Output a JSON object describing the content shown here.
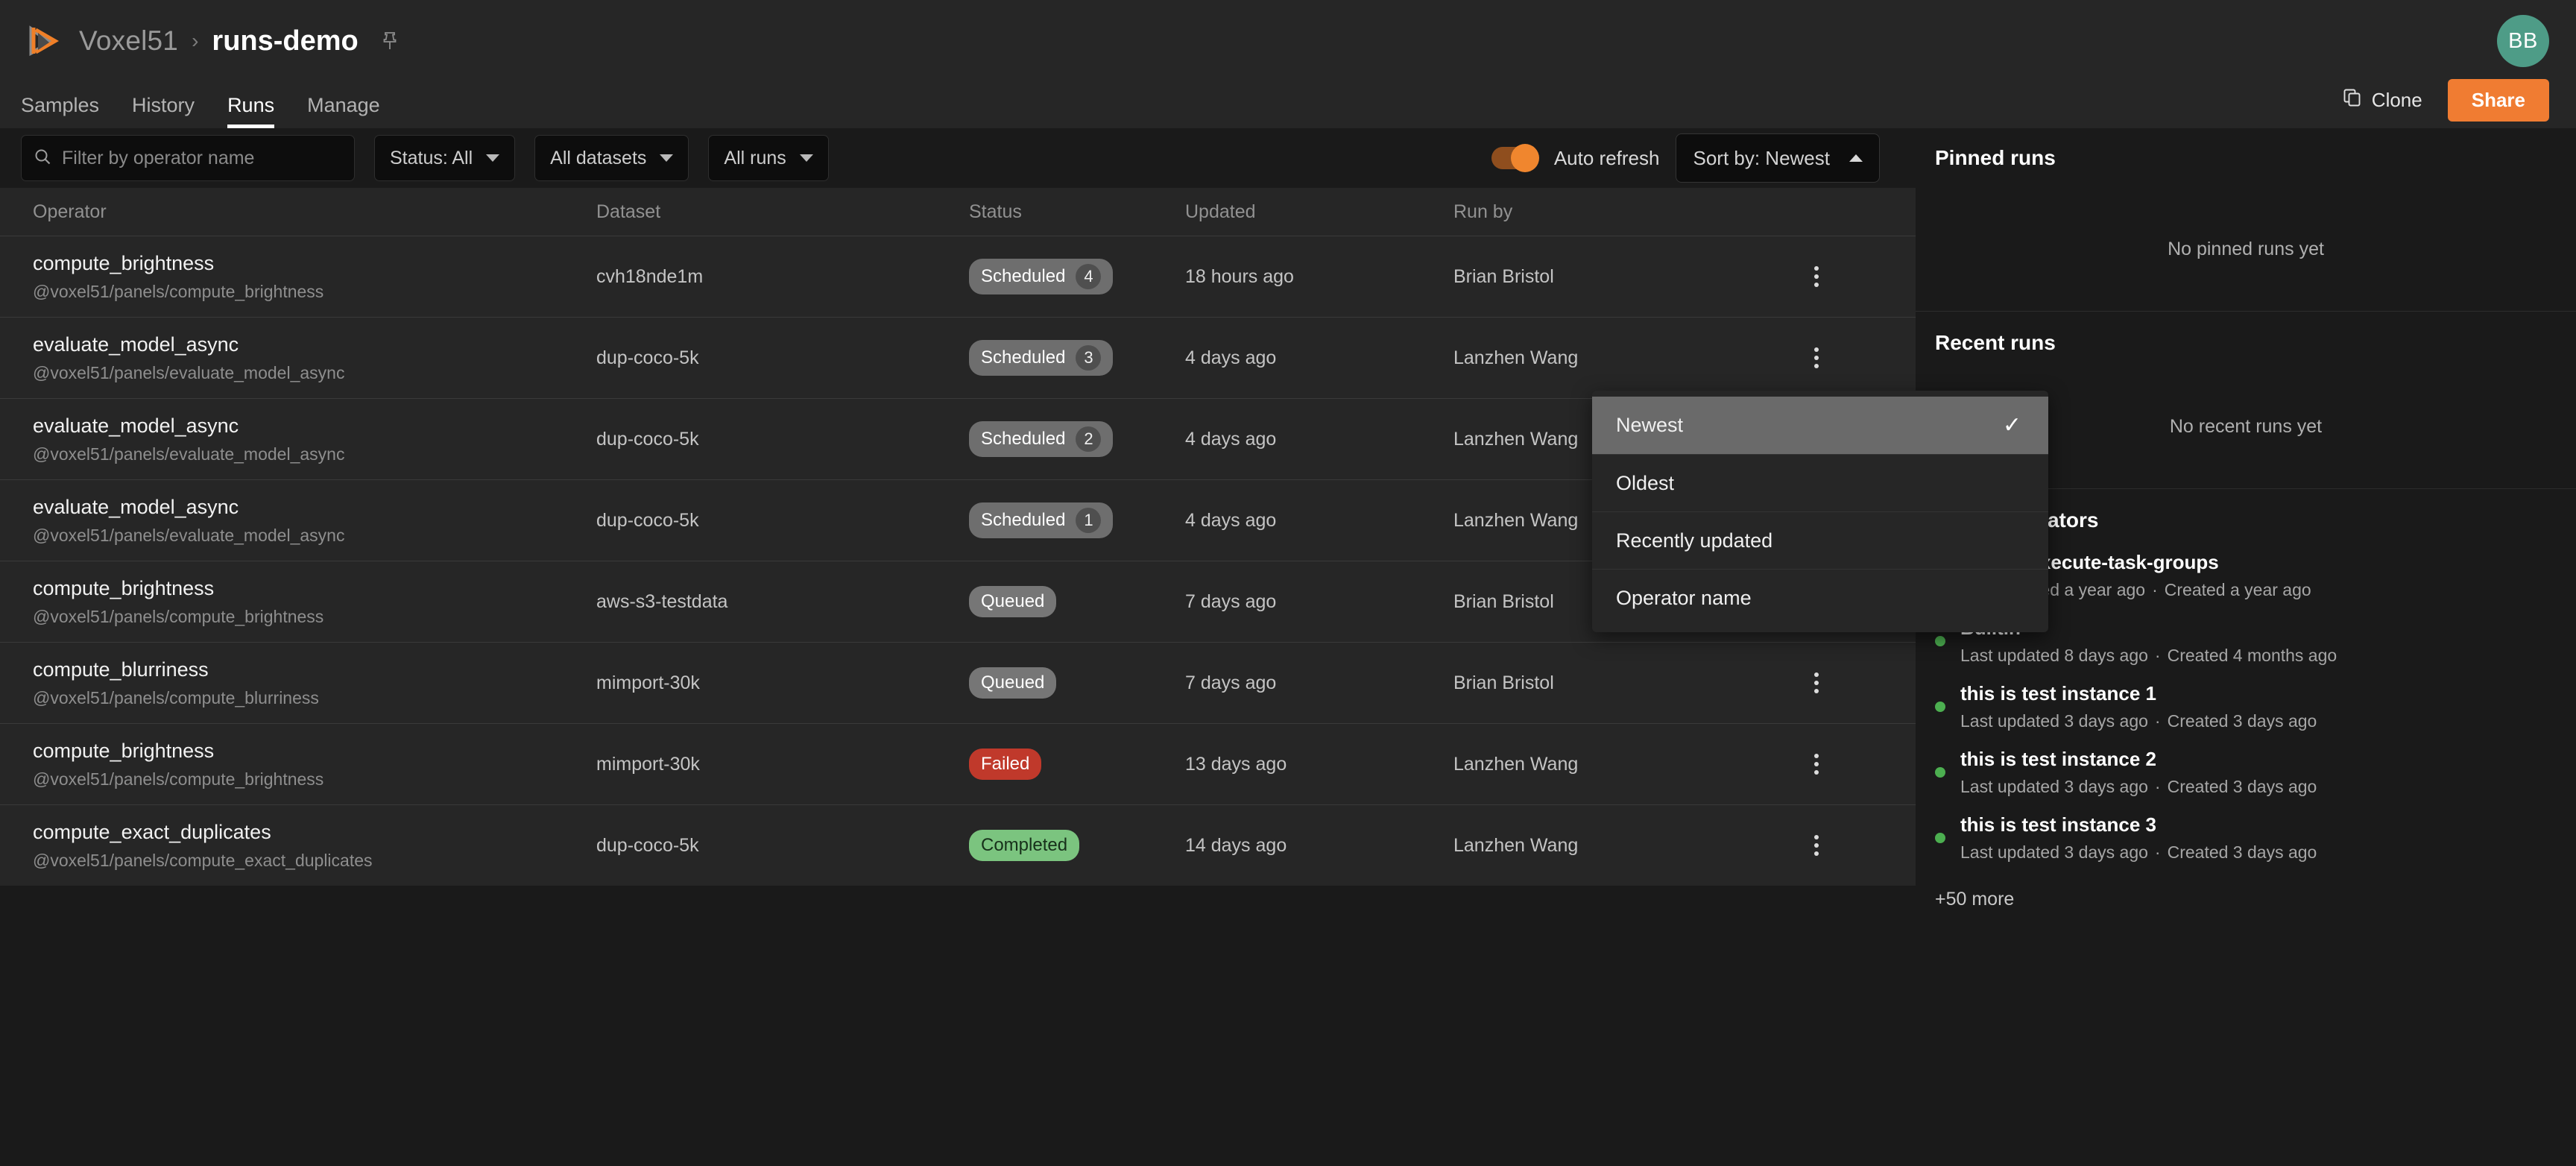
{
  "topbar": {
    "logo_icon": "voxel51-logo-icon",
    "org": "Voxel51",
    "separator": "›",
    "dataset": "runs-demo",
    "pin_icon": "pin-icon",
    "avatar_initials": "BB",
    "avatar_color": "#4e9c87"
  },
  "nav": {
    "tabs": [
      {
        "label": "Samples",
        "active": false
      },
      {
        "label": "History",
        "active": false
      },
      {
        "label": "Runs",
        "active": true
      },
      {
        "label": "Manage",
        "active": false
      }
    ],
    "clone_label": "Clone",
    "clone_icon": "copy-icon",
    "share_label": "Share",
    "share_color": "#f07c32"
  },
  "filters": {
    "search_icon": "search-icon",
    "search_placeholder": "Filter by operator name",
    "search_value": "",
    "status_filter": "Status: All",
    "dataset_filter": "All datasets",
    "runs_filter": "All runs",
    "auto_refresh_label": "Auto refresh",
    "auto_refresh_on": true,
    "sort_label": "Sort by: Newest",
    "caret_icon": "chevron-up-icon"
  },
  "sort_menu": {
    "open": true,
    "items": [
      {
        "label": "Newest",
        "selected": true
      },
      {
        "label": "Oldest",
        "selected": false
      },
      {
        "label": "Recently updated",
        "selected": false
      },
      {
        "label": "Operator name",
        "selected": false
      }
    ],
    "check_icon": "check-icon"
  },
  "table": {
    "columns": [
      "Operator",
      "Dataset",
      "Status",
      "Updated",
      "Run by"
    ],
    "rows": [
      {
        "operator": "compute_brightness",
        "uri": "@voxel51/panels/compute_brightness",
        "dataset": "cvh18nde1m",
        "status": "Scheduled",
        "status_kind": "scheduled",
        "count": "4",
        "updated": "18 hours ago",
        "run_by": "Brian Bristol",
        "menu_icon": "kebab-menu-icon"
      },
      {
        "operator": "evaluate_model_async",
        "uri": "@voxel51/panels/evaluate_model_async",
        "dataset": "dup-coco-5k",
        "status": "Scheduled",
        "status_kind": "scheduled",
        "count": "3",
        "updated": "4 days ago",
        "run_by": "Lanzhen Wang",
        "menu_icon": "kebab-menu-icon"
      },
      {
        "operator": "evaluate_model_async",
        "uri": "@voxel51/panels/evaluate_model_async",
        "dataset": "dup-coco-5k",
        "status": "Scheduled",
        "status_kind": "scheduled",
        "count": "2",
        "updated": "4 days ago",
        "run_by": "Lanzhen Wang",
        "menu_icon": "kebab-menu-icon"
      },
      {
        "operator": "evaluate_model_async",
        "uri": "@voxel51/panels/evaluate_model_async",
        "dataset": "dup-coco-5k",
        "status": "Scheduled",
        "status_kind": "scheduled",
        "count": "1",
        "updated": "4 days ago",
        "run_by": "Lanzhen Wang",
        "menu_icon": "kebab-menu-icon"
      },
      {
        "operator": "compute_brightness",
        "uri": "@voxel51/panels/compute_brightness",
        "dataset": "aws-s3-testdata",
        "status": "Queued",
        "status_kind": "queued",
        "count": "",
        "updated": "7 days ago",
        "run_by": "Brian Bristol",
        "menu_icon": "kebab-menu-icon"
      },
      {
        "operator": "compute_blurriness",
        "uri": "@voxel51/panels/compute_blurriness",
        "dataset": "mimport-30k",
        "status": "Queued",
        "status_kind": "queued",
        "count": "",
        "updated": "7 days ago",
        "run_by": "Brian Bristol",
        "menu_icon": "kebab-menu-icon"
      },
      {
        "operator": "compute_brightness",
        "uri": "@voxel51/panels/compute_brightness",
        "dataset": "mimport-30k",
        "status": "Failed",
        "status_kind": "failed",
        "count": "",
        "updated": "13 days ago",
        "run_by": "Lanzhen Wang",
        "menu_icon": "kebab-menu-icon"
      },
      {
        "operator": "compute_exact_duplicates",
        "uri": "@voxel51/panels/compute_exact_duplicates",
        "dataset": "dup-coco-5k",
        "status": "Completed",
        "status_kind": "completed",
        "count": "",
        "updated": "14 days ago",
        "run_by": "Lanzhen Wang",
        "menu_icon": "kebab-menu-icon"
      }
    ]
  },
  "sidebar": {
    "pinned_title": "Pinned runs",
    "pinned_empty": "No pinned runs yet",
    "recent_title": "Recent runs",
    "recent_empty": "No recent runs yet",
    "saved_title": "Saved operators",
    "saved_items": [
      {
        "name": "airflow-execute-task-groups",
        "updated": "Last updated a year ago",
        "created": "Created a year ago"
      },
      {
        "name": "Builtin",
        "updated": "Last updated 8 days ago",
        "created": "Created 4 months ago"
      },
      {
        "name": "this is test instance 1",
        "updated": "Last updated 3 days ago",
        "created": "Created 3 days ago"
      },
      {
        "name": "this is test instance 2",
        "updated": "Last updated 3 days ago",
        "created": "Created 3 days ago"
      },
      {
        "name": "this is test instance 3",
        "updated": "Last updated 3 days ago",
        "created": "Created 3 days ago"
      }
    ],
    "more_label": "+50 more",
    "status_dot_color": "#4caf50"
  }
}
